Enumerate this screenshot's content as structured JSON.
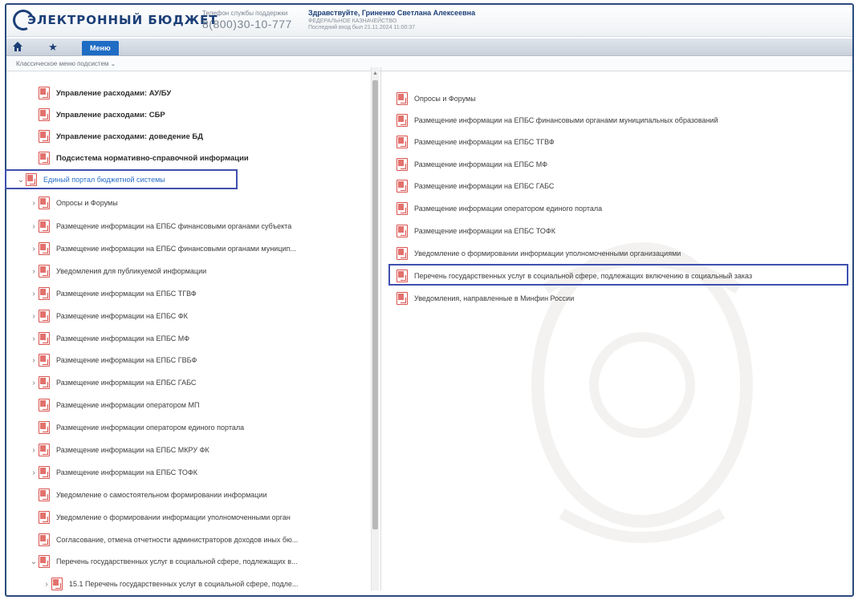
{
  "header": {
    "logo_text": "ЭЛЕКТРОННЫЙ БЮДЖЕТ",
    "support_label": "Телефон службы поддержки",
    "support_phone": "8(800)30-10-777",
    "greeting": "Здравствуйте, Гриненко Светлана Алексеевна",
    "org": "ФЕДЕРАЛЬНОЕ КАЗНАЧЕЙСТВО",
    "session": "Последний вход был 21.11.2024 11:00:37"
  },
  "nav": {
    "home_icon": "home-icon",
    "star_icon": "star-icon",
    "menu_label": "Меню"
  },
  "subbar": {
    "classic_menu": "Классическое меню подсистем ⌄"
  },
  "left_tree": [
    {
      "label": "Управление расходами: АУ/БУ",
      "caret": "",
      "bold": true,
      "selected": false
    },
    {
      "label": "Управление расходами: СБР",
      "caret": "",
      "bold": true,
      "selected": false
    },
    {
      "label": "Управление расходами: доведение БД",
      "caret": "",
      "bold": true,
      "selected": false
    },
    {
      "label": "Подсистема нормативно-справочной информации",
      "caret": "",
      "bold": true,
      "selected": false
    },
    {
      "label": "Единый портал бюджетной системы",
      "caret": "⌄",
      "bold": false,
      "selected": true
    },
    {
      "label": "Опросы и Форумы",
      "caret": "›",
      "bold": false,
      "selected": false
    },
    {
      "label": "Размещение информации на ЕПБС финансовыми органами субъекта",
      "caret": "›",
      "bold": false,
      "selected": false
    },
    {
      "label": "Размещение информации на ЕПБС финансовыми органами муницип...",
      "caret": "›",
      "bold": false,
      "selected": false
    },
    {
      "label": "Уведомления для публикуемой информации",
      "caret": "›",
      "bold": false,
      "selected": false
    },
    {
      "label": "Размещение информации на ЕПБС ТГВФ",
      "caret": "›",
      "bold": false,
      "selected": false
    },
    {
      "label": "Размещение информации на ЕПБС ФК",
      "caret": "›",
      "bold": false,
      "selected": false
    },
    {
      "label": "Размещение информации на ЕПБС МФ",
      "caret": "›",
      "bold": false,
      "selected": false
    },
    {
      "label": "Размещение информации на ЕПБС ГВБФ",
      "caret": "›",
      "bold": false,
      "selected": false
    },
    {
      "label": "Размещение информации на ЕПБС ГАБС",
      "caret": "›",
      "bold": false,
      "selected": false
    },
    {
      "label": "Размещение информации оператором МП",
      "caret": "",
      "bold": false,
      "selected": false
    },
    {
      "label": "Размещение информации оператором единого портала",
      "caret": "",
      "bold": false,
      "selected": false
    },
    {
      "label": "Размещение информации на ЕПБС МКРУ ФК",
      "caret": "›",
      "bold": false,
      "selected": false
    },
    {
      "label": "Размещение информации на ЕПБС ТОФК",
      "caret": "›",
      "bold": false,
      "selected": false
    },
    {
      "label": "Уведомление о самостоятельном формировании информации",
      "caret": "",
      "bold": false,
      "selected": false
    },
    {
      "label": "Уведомление о формировании информации уполномоченными орган",
      "caret": "",
      "bold": false,
      "selected": false
    },
    {
      "label": "Согласование, отмена отчетности администраторов доходов иных бю...",
      "caret": "",
      "bold": false,
      "selected": false
    },
    {
      "label": "Перечень государственных услуг в социальной сфере, подлежащих в...",
      "caret": "⌄",
      "bold": false,
      "selected": false
    },
    {
      "label": "15.1 Перечень государственных услуг в социальной сфере, подле...",
      "caret": "›",
      "bold": false,
      "selected": false
    }
  ],
  "right_list": [
    "Опросы и Форумы",
    "Размещение информации на ЕПБС финансовыми органами муниципальных образований",
    "Размещение информации на ЕПБС ТГВФ",
    "Размещение информации на ЕПБС МФ",
    "Размещение информации на ЕПБС ГАБС",
    "Размещение информации оператором единого портала",
    "Размещение информации на ЕПБС ТОФК",
    "Уведомление о формировании информации уполномоченными организациями",
    "Перечень государственных услуг в социальной сфере, подлежащих включению в социальный заказ",
    "Уведомления, направленные в Минфин России"
  ],
  "colors": {
    "brand": "#1c3f78",
    "menu_tab": "#1f6cc4",
    "highlight_box": "#3f4fae",
    "doc_icon": "#d9534f",
    "selected_text": "#2a6fc9"
  }
}
